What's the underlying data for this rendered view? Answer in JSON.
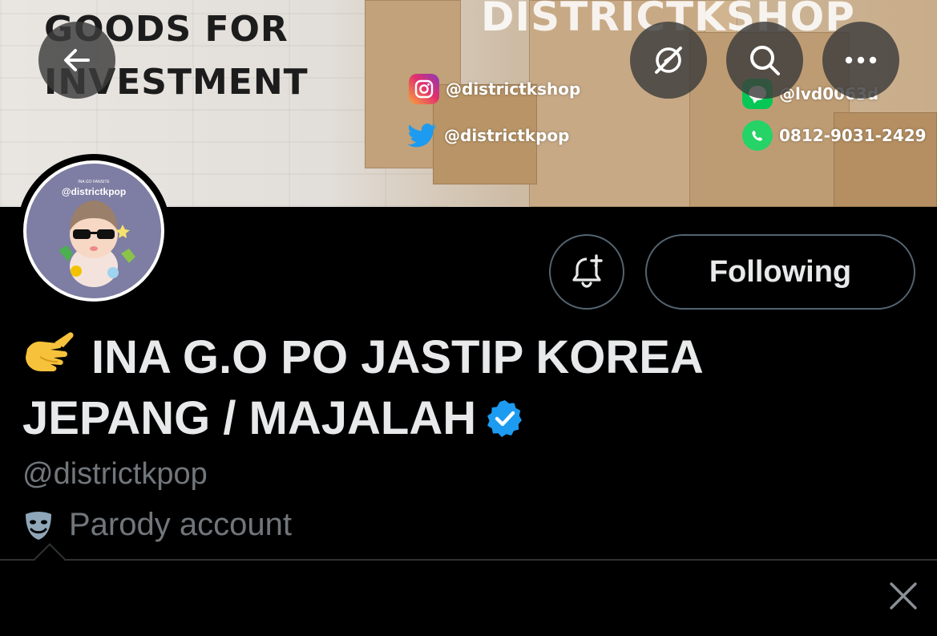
{
  "banner": {
    "title_line1": "GOODS FOR",
    "title_line2": "INVESTMENT",
    "shop_name": "DISTRICTKSHOP",
    "contacts": {
      "instagram": "@districtkshop",
      "twitter": "@districtkpop",
      "line": "@lvd0063d",
      "whatsapp": "0812-9031-2429"
    }
  },
  "header": {
    "back_icon": "arrow-left-icon",
    "grok_icon": "grok-icon",
    "search_icon": "search-icon",
    "more_icon": "more-horizontal-icon"
  },
  "profile": {
    "avatar_small_text": "INA GO FANSITE",
    "avatar_handle": "@districtkpop",
    "display_name": "INA G.O PO JASTIP KOREA JEPANG / MAJALAH",
    "name_emoji": "call-me-hand-emoji",
    "verified_icon": "verified-badge-icon",
    "handle": "@districtkpop",
    "label_icon": "parody-mask-icon",
    "label": "Parody account"
  },
  "actions": {
    "notify_icon": "bell-plus-icon",
    "following_label": "Following"
  },
  "colors": {
    "background": "#000000",
    "text_primary": "#e7e9ea",
    "text_secondary": "#71767b",
    "border": "#536471",
    "verified": "#1d9bf0"
  }
}
